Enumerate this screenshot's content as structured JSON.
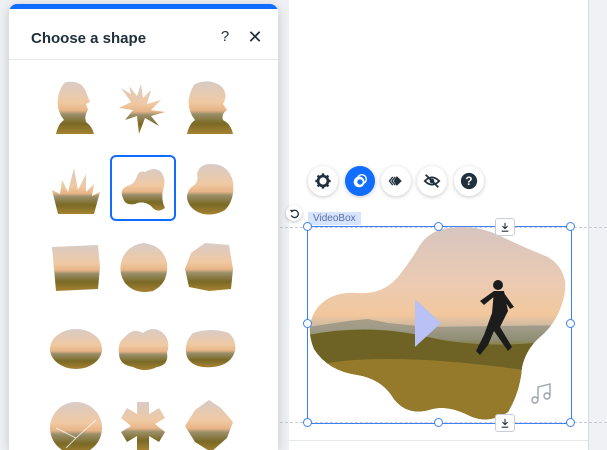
{
  "panel": {
    "title": "Choose a shape",
    "help_label": "?",
    "close_label": "✕",
    "shapes": [
      {
        "name": "head-profile"
      },
      {
        "name": "branch"
      },
      {
        "name": "tree-head"
      },
      {
        "name": "crown-leaves"
      },
      {
        "name": "blob-selected",
        "selected": true
      },
      {
        "name": "round-blob"
      },
      {
        "name": "torn-square"
      },
      {
        "name": "pebble"
      },
      {
        "name": "rough-square"
      },
      {
        "name": "oval"
      },
      {
        "name": "cloud"
      },
      {
        "name": "flat-blob"
      },
      {
        "name": "circle-cracked"
      },
      {
        "name": "flower"
      },
      {
        "name": "diamond-rough"
      }
    ]
  },
  "toolbar": {
    "buttons": [
      {
        "name": "settings",
        "icon": "gear-icon",
        "active": false
      },
      {
        "name": "mask",
        "icon": "mask-icon",
        "active": true
      },
      {
        "name": "animation",
        "icon": "animation-icon",
        "active": false
      },
      {
        "name": "hide",
        "icon": "eye-off-icon",
        "active": false
      },
      {
        "name": "help",
        "icon": "help-icon",
        "label": "?",
        "active": false
      }
    ]
  },
  "element": {
    "label": "VideoBox"
  },
  "colors": {
    "accent": "#116dff",
    "selection": "#3b82f6",
    "sky_top": "#d9c8c0",
    "sky_mid": "#f2cba6",
    "grass": "#8a7a2e",
    "play": "#b9c1f5"
  }
}
